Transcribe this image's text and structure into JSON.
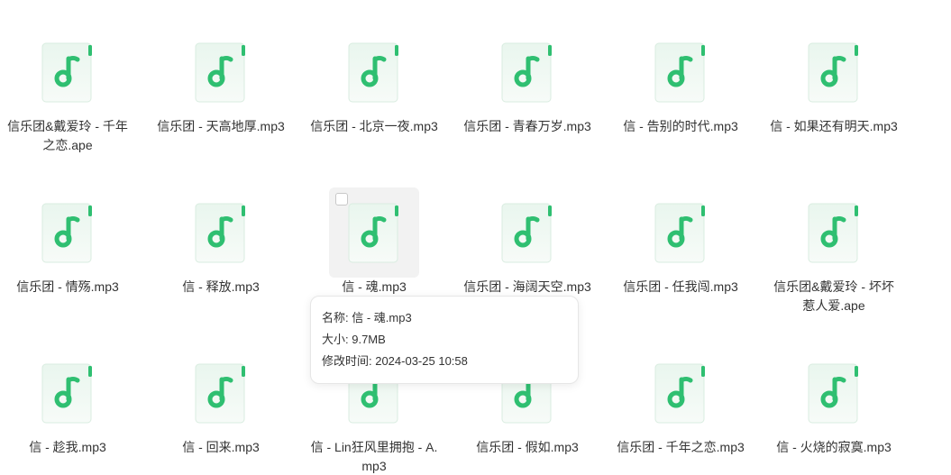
{
  "files": [
    {
      "name": "信乐团&戴爱玲 - 千年之恋.ape",
      "icon": "music-file-icon"
    },
    {
      "name": "信乐团 - 天高地厚.mp3",
      "icon": "music-file-icon"
    },
    {
      "name": "信乐团 - 北京一夜.mp3",
      "icon": "music-file-icon"
    },
    {
      "name": "信乐团 - 青春万岁.mp3",
      "icon": "music-file-icon"
    },
    {
      "name": "信 - 告别的时代.mp3",
      "icon": "music-file-icon"
    },
    {
      "name": "信 - 如果还有明天.mp3",
      "icon": "music-file-icon"
    },
    {
      "name": "信乐团 - 情殇.mp3",
      "icon": "music-file-icon"
    },
    {
      "name": "信 - 释放.mp3",
      "icon": "music-file-icon"
    },
    {
      "name": "信 - 魂.mp3",
      "icon": "music-file-icon"
    },
    {
      "name": "信乐团 - 海阔天空.mp3",
      "icon": "music-file-icon"
    },
    {
      "name": "信乐团 - 任我闯.mp3",
      "icon": "music-file-icon"
    },
    {
      "name": "信乐团&戴爱玲 - 坏坏惹人爱.ape",
      "icon": "music-file-icon"
    },
    {
      "name": "信 - 趁我.mp3",
      "icon": "music-file-icon"
    },
    {
      "name": "信 - 回来.mp3",
      "icon": "music-file-icon"
    },
    {
      "name": "信 - Lin狂风里拥抱 - A.mp3",
      "icon": "music-file-icon"
    },
    {
      "name": "信乐团 - 假如.mp3",
      "icon": "music-file-icon"
    },
    {
      "name": "信乐团 - 千年之恋.mp3",
      "icon": "music-file-icon"
    },
    {
      "name": "信 - 火烧的寂寞.mp3",
      "icon": "music-file-icon"
    }
  ],
  "hovered_index": 8,
  "tooltip": {
    "name_line": "名称: 信 - 魂.mp3",
    "size_line": "大小: 9.7MB",
    "modified_line": "修改时间: 2024-03-25 10:58"
  },
  "colors": {
    "icon_green": "#2fbf71",
    "icon_bg": "#eef8f2"
  }
}
